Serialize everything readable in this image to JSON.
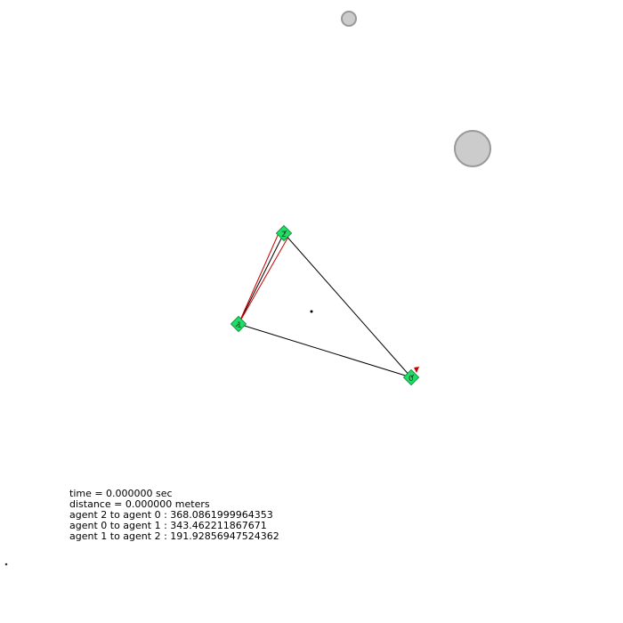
{
  "simulation": {
    "time_text": "time = 0.000000 sec",
    "distance_text": "distance = 0.000000 meters",
    "pair_distances": [
      "agent 2 to agent 0 : 368.0861999964353",
      "agent 0 to agent 1 : 343.462211867671",
      "agent 1 to agent 2 : 191.92856947524362"
    ]
  },
  "agents": [
    {
      "id": "0",
      "label": "0",
      "color": "#22dd66"
    },
    {
      "id": "1",
      "label": "1",
      "color": "#22dd66"
    },
    {
      "id": "2",
      "label": "2",
      "color": "#22dd66"
    }
  ],
  "obstacles": [
    {
      "name": "obstacle-small",
      "color": "#cccccc",
      "stroke": "#999999"
    },
    {
      "name": "obstacle-large",
      "color": "#cccccc",
      "stroke": "#999999"
    }
  ],
  "colors": {
    "agent_fill": "#22dd66",
    "link_line": "#000000",
    "sensor_ray": "#cc0000",
    "goal_marker": "#cc0000",
    "obstacle_fill": "#cccccc",
    "obstacle_stroke": "#999999"
  }
}
